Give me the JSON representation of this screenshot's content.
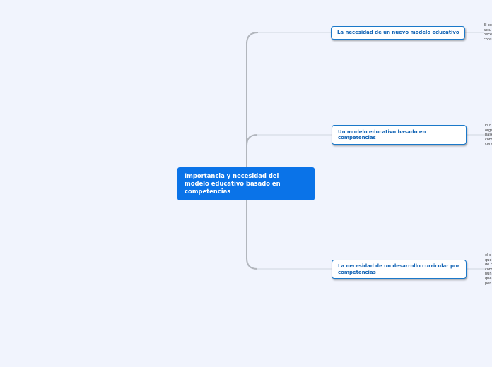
{
  "central_topic": {
    "label": "Importancia y necesidad del\nmodelo educativo basado en\ncompetencias"
  },
  "branches": [
    {
      "label": "La necesidad de un nuevo modelo educativo",
      "note": "El co\nactu\nnece\ncons"
    },
    {
      "label": "Un modelo educativo basado en\ncompetencias",
      "note": "El n\norga\nbase\ncom\nconc"
    },
    {
      "label": "La necesidad de un desarrollo curricular por\ncompetencias",
      "note": "el c\nque\nde c\ncom\nhun\nque\npen"
    }
  ],
  "colors": {
    "background": "#f1f4fd",
    "central_fill": "#0a73e8",
    "topic_border": "#1b78c9",
    "topic_text": "#1465b5",
    "trunk_line": "#b2b6bd",
    "branch_line": "#d0d6e0"
  }
}
